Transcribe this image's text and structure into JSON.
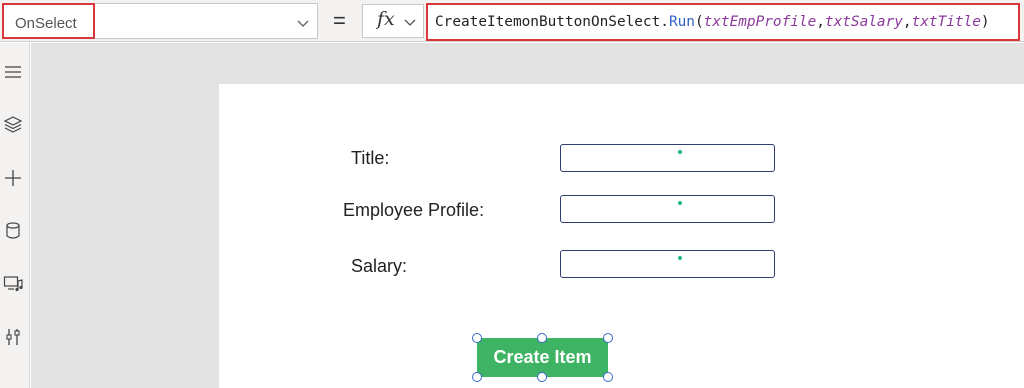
{
  "formula_bar": {
    "property": "OnSelect",
    "equals": "=",
    "fx_label": "fx",
    "formula": {
      "function_name": "CreateItemonButtonOnSelect.",
      "method": "Run",
      "open_paren": "(",
      "arg1": "txtEmpProfile",
      "sep1": ",",
      "arg2": "txtSalary",
      "sep2": ",",
      "arg3": "txtTitle",
      "close_paren": ")"
    },
    "highlight_color": "#d9383a"
  },
  "rail": {
    "icons": [
      "hamburger-icon",
      "layers-icon",
      "plus-icon",
      "database-icon",
      "media-icon",
      "tools-icon"
    ]
  },
  "form": {
    "title_label": "Title:",
    "employee_profile_label": "Employee Profile:",
    "salary_label": "Salary:",
    "button_label": "Create Item",
    "button_color": "#3fb364"
  }
}
